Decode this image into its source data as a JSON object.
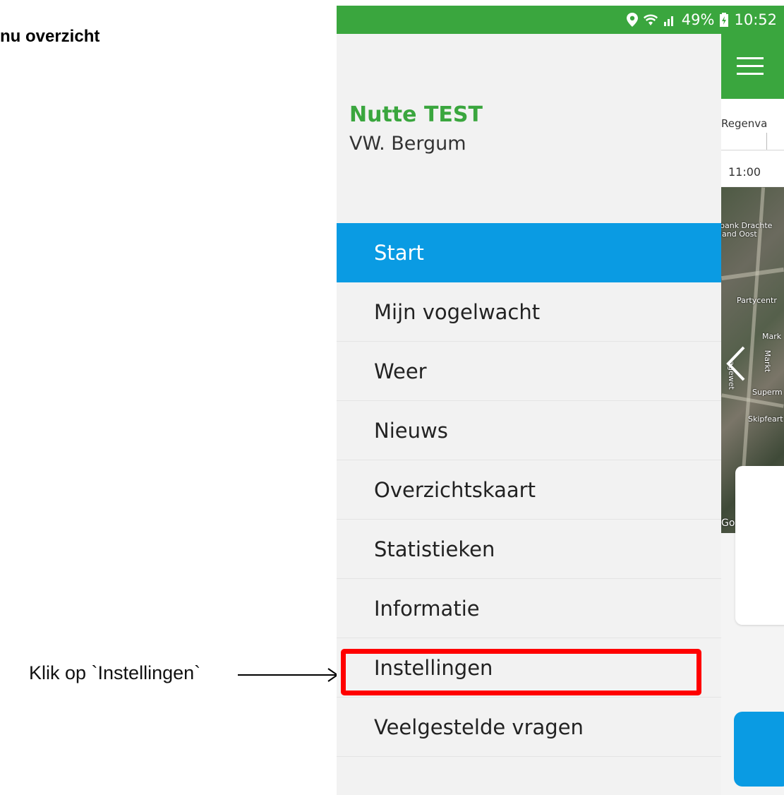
{
  "doc": {
    "title": "nu overzicht",
    "annotation": "Klik op `Instellingen`"
  },
  "statusbar": {
    "location_icon": "location-pin-icon",
    "wifi_icon": "wifi-icon",
    "signal_icon": "signal-icon",
    "battery": "49%",
    "battery_icon": "battery-charging-icon",
    "time": "10:52"
  },
  "background_app": {
    "tab_label": "Regenva",
    "time_label": "11:00",
    "map_labels": [
      "bank Drachte",
      "land Oost",
      "Partycentr",
      "Mark",
      "Markt",
      "Superm",
      "Skipfeart",
      "agewet",
      "Go"
    ]
  },
  "drawer": {
    "user_name": "Nutte TEST",
    "organization": "VW. Bergum",
    "items": [
      {
        "label": "Start",
        "active": true
      },
      {
        "label": "Mijn vogelwacht",
        "active": false
      },
      {
        "label": "Weer",
        "active": false
      },
      {
        "label": "Nieuws",
        "active": false
      },
      {
        "label": "Overzichtskaart",
        "active": false
      },
      {
        "label": "Statistieken",
        "active": false
      },
      {
        "label": "Informatie",
        "active": false
      },
      {
        "label": "Instellingen",
        "active": false
      },
      {
        "label": "Veelgestelde vragen",
        "active": false
      }
    ]
  },
  "colors": {
    "brand_green": "#3aa63e",
    "active_blue": "#0a9be3",
    "highlight_red": "#ff0000"
  }
}
